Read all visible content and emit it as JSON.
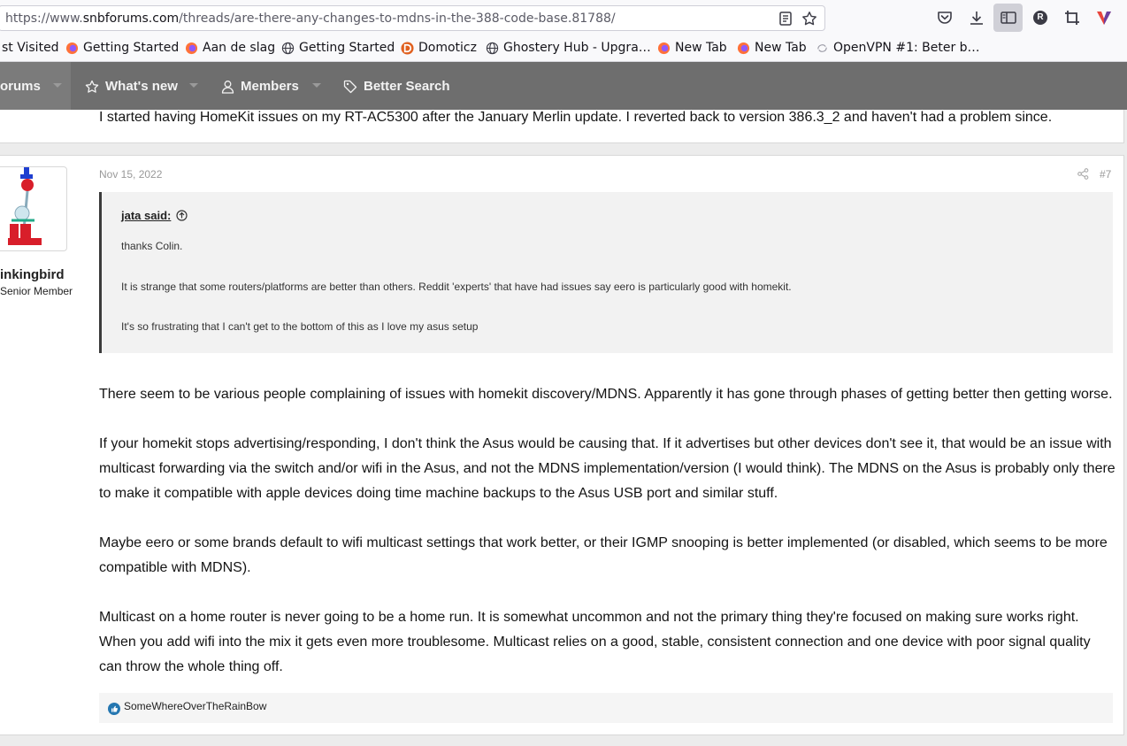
{
  "browser": {
    "url_prefix": "https://www.",
    "url_domain": "snbforums.com",
    "url_path": "/threads/are-there-any-changes-to-mdns-in-the-388-code-base.81788/",
    "profile_initial": "R"
  },
  "bookmarks": [
    {
      "label": "st Visited"
    },
    {
      "label": "Getting Started"
    },
    {
      "label": "Aan de slag"
    },
    {
      "label": "Getting Started"
    },
    {
      "label": "Domoticz"
    },
    {
      "label": "Ghostery Hub - Upgra…"
    },
    {
      "label": "New Tab"
    },
    {
      "label": "New Tab"
    },
    {
      "label": "OpenVPN #1: Beter b…"
    }
  ],
  "nav": {
    "forums": "orums",
    "whats_new": "What's new",
    "members": "Members",
    "better_search": "Better Search"
  },
  "previous_post": {
    "text": "I started having HomeKit issues on my RT-AC5300 after the January Merlin update. I reverted back to version 386.3_2 and haven't had a problem since."
  },
  "post": {
    "author": "inkingbird",
    "author_title": "Senior Member",
    "date": "Nov 15, 2022",
    "number": "#7",
    "quote": {
      "attribution": "jata said:",
      "lines": [
        "thanks Colin.",
        "It is strange that some routers/platforms are better than others. Reddit 'experts' that have had issues say eero is particularly good with homekit.",
        "It's so frustrating that I can't get to the bottom of this as I love my asus setup"
      ]
    },
    "paragraphs": [
      "There seem to be various people complaining of issues with homekit discovery/MDNS. Apparently it has gone through phases of getting better then getting worse.",
      "If your homekit stops advertising/responding, I don't think the Asus would be causing that. If it advertises but other devices don't see it, that would be an issue with multicast forwarding via the switch and/or wifi in the Asus, and not the MDNS implementation/version (I would think). The MDNS on the Asus is probably only there to make it compatible with apple devices doing time machine backups to the Asus USB port and similar stuff.",
      "Maybe eero or some brands default to wifi multicast settings that work better, or their IGMP snooping is better implemented (or disabled, which seems to be more compatible with MDNS).",
      "Multicast on a home router is never going to be a home run. It is somewhat uncommon and not the primary thing they're focused on making sure works right. When you add wifi into the mix it gets even more troublesome. Multicast relies on a good, stable, consistent connection and one device with poor signal quality can throw the whole thing off."
    ],
    "reaction_user": "SomeWhereOverTheRainBow"
  },
  "colors": {
    "nav_bg": "#6e6e6e",
    "quote_border": "#3b3b3b",
    "like_blue": "#2577b1"
  }
}
